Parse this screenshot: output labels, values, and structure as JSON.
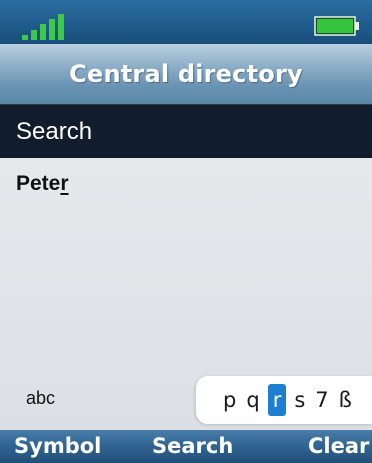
{
  "status": {
    "signal_icon": "signal-strength-icon",
    "signal_bars": 5,
    "signal_color": "#3ec94a",
    "battery_icon": "battery-icon",
    "battery_level": 1.0,
    "battery_color": "#36c43f"
  },
  "header": {
    "title": "Central directory"
  },
  "search": {
    "label": "Search"
  },
  "entry": {
    "text_main": "Pete",
    "text_cursor": "r"
  },
  "input_mode": {
    "label": "abc"
  },
  "char_picker": {
    "chars": [
      "p",
      "q",
      "r",
      "s",
      "7",
      "ß"
    ],
    "selected_index": 2,
    "selected_color": "#1d7fd0"
  },
  "softkeys": {
    "left": "Symbol",
    "center": "Search",
    "right": "Clear"
  },
  "colors": {
    "status_bar": "#1f5c8c",
    "title_bar": "#7aa0be",
    "search_bar": "#111c2d",
    "content_bg": "#dfe2e6",
    "softkey_bar": "#2f6391"
  }
}
